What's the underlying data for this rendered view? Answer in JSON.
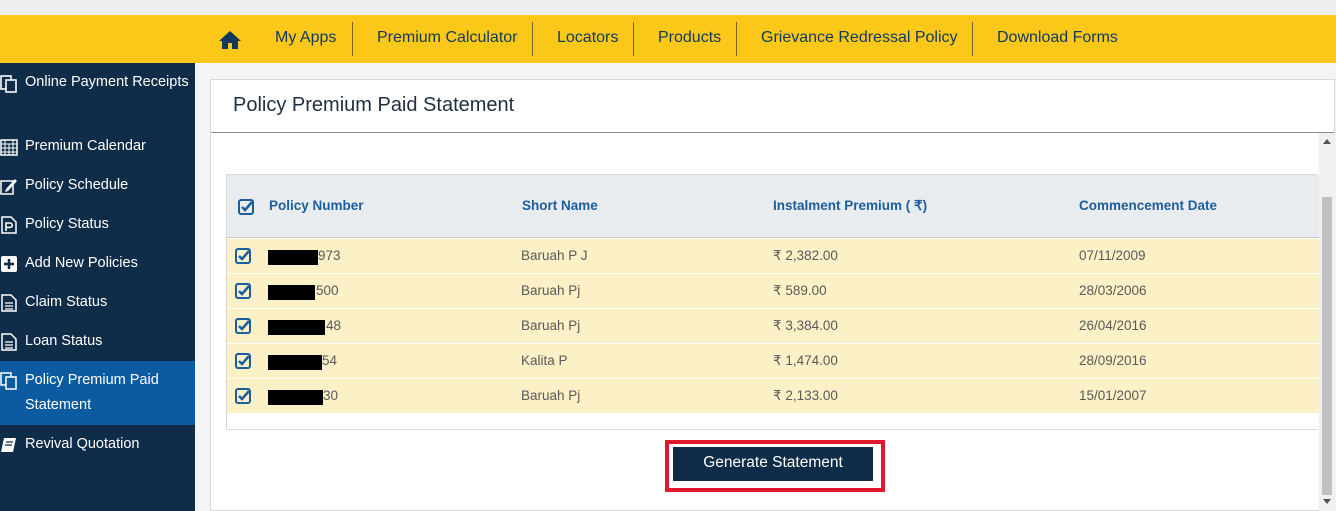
{
  "nav": {
    "home_icon": "home-icon",
    "items": [
      "My Apps",
      "Premium Calculator",
      "Locators",
      "Products",
      "Grievance Redressal Policy",
      "Download Forms"
    ]
  },
  "sidebar": {
    "items": [
      {
        "label": "Online Payment Receipts",
        "icon": "receipts-icon"
      },
      {
        "label": "Premium Calendar",
        "icon": "calendar-icon"
      },
      {
        "label": "Policy Schedule",
        "icon": "edit-icon"
      },
      {
        "label": "Policy Status",
        "icon": "policy-p-icon"
      },
      {
        "label": "Add New Policies",
        "icon": "plus-icon"
      },
      {
        "label": "Claim Status",
        "icon": "document-icon"
      },
      {
        "label": "Loan Status",
        "icon": "document-icon"
      },
      {
        "label": "Policy Premium Paid Statement",
        "icon": "copy-icon",
        "active": true
      },
      {
        "label": "Revival Quotation",
        "icon": "book-icon"
      }
    ]
  },
  "page": {
    "title": "Policy Premium Paid Statement"
  },
  "table": {
    "headers": [
      "Policy Number",
      "Short Name",
      "Instalment Premium ( ₹)",
      "Commencement Date"
    ],
    "header_checked": true,
    "rows": [
      {
        "policy_suffix": "973",
        "short_name": "Baruah P J",
        "premium": "₹ 2,382.00",
        "date": "07/11/2009",
        "checked": true
      },
      {
        "policy_suffix": "500",
        "short_name": "Baruah Pj",
        "premium": "₹ 589.00",
        "date": "28/03/2006",
        "checked": true
      },
      {
        "policy_suffix": "48",
        "short_name": "Baruah Pj",
        "premium": "₹ 3,384.00",
        "date": "26/04/2016",
        "checked": true
      },
      {
        "policy_suffix": "54",
        "short_name": "Kalita P",
        "premium": "₹ 1,474.00",
        "date": "28/09/2016",
        "checked": true
      },
      {
        "policy_suffix": "30",
        "short_name": "Baruah Pj",
        "premium": "₹ 2,133.00",
        "date": "15/01/2007",
        "checked": true
      }
    ]
  },
  "actions": {
    "generate_label": "Generate Statement"
  },
  "colors": {
    "navbar": "#fbc81a",
    "sidebar": "#0f2c48",
    "active": "#0c5aa0",
    "row": "#fbf0c6",
    "header_text": "#1b5e9e",
    "highlight": "#e0192a"
  }
}
